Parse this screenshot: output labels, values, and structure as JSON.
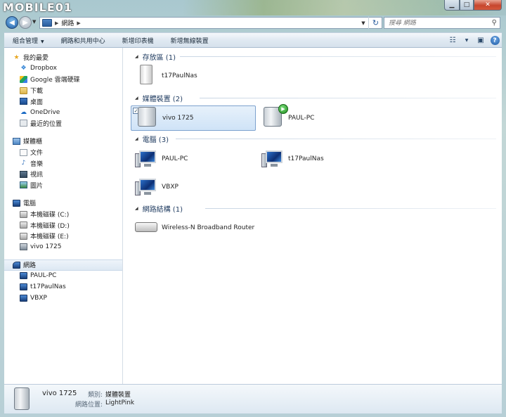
{
  "watermark": "MOBILE01",
  "window": {
    "minimize": "▁",
    "maximize": "□",
    "close": "✕"
  },
  "address": {
    "crumbs": [
      "網路"
    ],
    "search_placeholder": "搜尋 網路"
  },
  "toolbar": {
    "items": [
      "組合管理",
      "網路和共用中心",
      "新增印表機",
      "新增無線裝置"
    ]
  },
  "nav": {
    "favorites": {
      "label": "我的最愛",
      "items": [
        "Dropbox",
        "Google 雲端硬碟",
        "下載",
        "桌面",
        "OneDrive",
        "最近的位置"
      ]
    },
    "libraries": {
      "label": "媒體櫃",
      "items": [
        "文件",
        "音樂",
        "視訊",
        "圖片"
      ]
    },
    "computer": {
      "label": "電腦",
      "items": [
        "本機磁碟 (C:)",
        "本機磁碟 (D:)",
        "本機磁碟 (E:)",
        "vivo 1725"
      ]
    },
    "network": {
      "label": "網路",
      "items": [
        "PAUL-PC",
        "t17PaulNas",
        "VBXP"
      ]
    }
  },
  "content": {
    "groups": [
      {
        "title": "存放區 (1)",
        "items": [
          "t17PaulNas"
        ]
      },
      {
        "title": "媒體裝置 (2)",
        "items": [
          "vivo 1725",
          "PAUL-PC"
        ]
      },
      {
        "title": "電腦 (3)",
        "items": [
          "PAUL-PC",
          "t17PaulNas",
          "VBXP"
        ]
      },
      {
        "title": "網路結構 (1)",
        "items": [
          "Wireless-N Broadband Router"
        ]
      }
    ]
  },
  "details": {
    "name": "vivo 1725",
    "category_label": "類別:",
    "category_value": "媒體裝置",
    "location_label": "網路位置:",
    "location_value": "LightPink"
  }
}
